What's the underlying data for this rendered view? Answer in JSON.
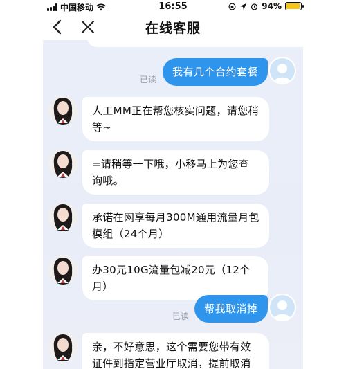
{
  "status_bar": {
    "carrier": "中国移动",
    "time": "16:55",
    "battery_percent": "94%",
    "battery_level": 0.94
  },
  "nav": {
    "title": "在线客服",
    "back_icon": "chevron-left-icon",
    "close_icon": "close-icon"
  },
  "messages": [
    {
      "from": "user",
      "text": "我有几个合约套餐",
      "read": "已读"
    },
    {
      "from": "agent",
      "text": "人工MM正在帮您核实问题，请您稍等~"
    },
    {
      "from": "agent",
      "text": "=请稍等一下哦，小移马上为您查询哦。"
    },
    {
      "from": "agent",
      "text": "承诺在网享每月300M通用流量月包模组（24个月）"
    },
    {
      "from": "agent",
      "text": "办30元10G流量包减20元（12个月）"
    },
    {
      "from": "user",
      "text": "帮我取消掉",
      "read": "已读"
    },
    {
      "from": "agent",
      "text": "亲，不好意思，这个需要您带有效证件到指定营业厅取消，提前取消可能"
    }
  ],
  "colors": {
    "user_bubble": "#2f95ec",
    "chat_background": "#eaeef8",
    "battery": "#f5c518"
  }
}
